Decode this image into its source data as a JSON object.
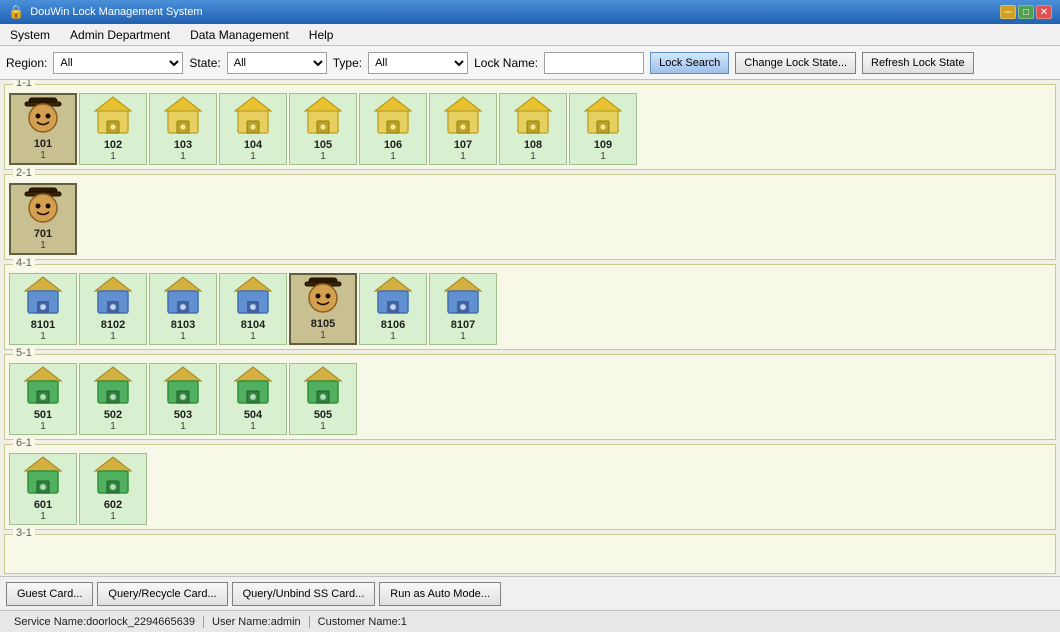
{
  "titleBar": {
    "title": "DouWin Lock Management System",
    "controls": [
      "min",
      "max",
      "close"
    ]
  },
  "menuBar": {
    "items": [
      "System",
      "Admin Department",
      "Data Management",
      "Help"
    ]
  },
  "toolbar": {
    "regionLabel": "Region:",
    "regionOptions": [
      "All"
    ],
    "regionValue": "All",
    "stateLabel": "State:",
    "stateOptions": [
      "All"
    ],
    "stateValue": "All",
    "typeLabel": "Type:",
    "typeOptions": [
      "All"
    ],
    "typeValue": "All",
    "lockNameLabel": "Lock Name:",
    "lockNameValue": "",
    "lockSearchBtn": "Lock Search",
    "changeLockStateBtn": "Change Lock State...",
    "refreshLockStateBtn": "Refresh Lock State"
  },
  "sections": [
    {
      "id": "section-1-1",
      "label": "1-1",
      "locks": [
        {
          "name": "101",
          "count": "1",
          "selected": true,
          "type": "person"
        },
        {
          "name": "102",
          "count": "1",
          "selected": false,
          "type": "chest"
        },
        {
          "name": "103",
          "count": "1",
          "selected": false,
          "type": "chest"
        },
        {
          "name": "104",
          "count": "1",
          "selected": false,
          "type": "chest"
        },
        {
          "name": "105",
          "count": "1",
          "selected": false,
          "type": "chest"
        },
        {
          "name": "106",
          "count": "1",
          "selected": false,
          "type": "chest"
        },
        {
          "name": "107",
          "count": "1",
          "selected": false,
          "type": "chest"
        },
        {
          "name": "108",
          "count": "1",
          "selected": false,
          "type": "chest"
        },
        {
          "name": "109",
          "count": "1",
          "selected": false,
          "type": "chest"
        }
      ]
    },
    {
      "id": "section-2-1",
      "label": "2-1",
      "locks": [
        {
          "name": "701",
          "count": "1",
          "selected": true,
          "type": "person"
        }
      ]
    },
    {
      "id": "section-4-1",
      "label": "4-1",
      "locks": [
        {
          "name": "8101",
          "count": "1",
          "selected": false,
          "type": "chest-blue"
        },
        {
          "name": "8102",
          "count": "1",
          "selected": false,
          "type": "chest-blue"
        },
        {
          "name": "8103",
          "count": "1",
          "selected": false,
          "type": "chest-blue"
        },
        {
          "name": "8104",
          "count": "1",
          "selected": false,
          "type": "chest-blue"
        },
        {
          "name": "8105",
          "count": "1",
          "selected": true,
          "type": "person"
        },
        {
          "name": "8106",
          "count": "1",
          "selected": false,
          "type": "chest-blue"
        },
        {
          "name": "8107",
          "count": "1",
          "selected": false,
          "type": "chest-blue"
        }
      ]
    },
    {
      "id": "section-5-1",
      "label": "5-1",
      "locks": [
        {
          "name": "501",
          "count": "1",
          "selected": false,
          "type": "chest-green"
        },
        {
          "name": "502",
          "count": "1",
          "selected": false,
          "type": "chest-green"
        },
        {
          "name": "503",
          "count": "1",
          "selected": false,
          "type": "chest-green"
        },
        {
          "name": "504",
          "count": "1",
          "selected": false,
          "type": "chest-green"
        },
        {
          "name": "505",
          "count": "1",
          "selected": false,
          "type": "chest-green"
        }
      ]
    },
    {
      "id": "section-6-1",
      "label": "6-1",
      "locks": [
        {
          "name": "601",
          "count": "1",
          "selected": false,
          "type": "chest-green"
        },
        {
          "name": "602",
          "count": "1",
          "selected": false,
          "type": "chest-green"
        }
      ]
    },
    {
      "id": "section-3-1",
      "label": "3-1",
      "locks": []
    }
  ],
  "bottomButtons": [
    "Guest Card...",
    "Query/Recycle Card...",
    "Query/Unbind SS Card...",
    "Run as Auto Mode..."
  ],
  "statusBar": {
    "serviceName": "Service Name:doorlock_2294665639",
    "userName": "User Name:admin",
    "customerName": "Customer Name:1"
  }
}
